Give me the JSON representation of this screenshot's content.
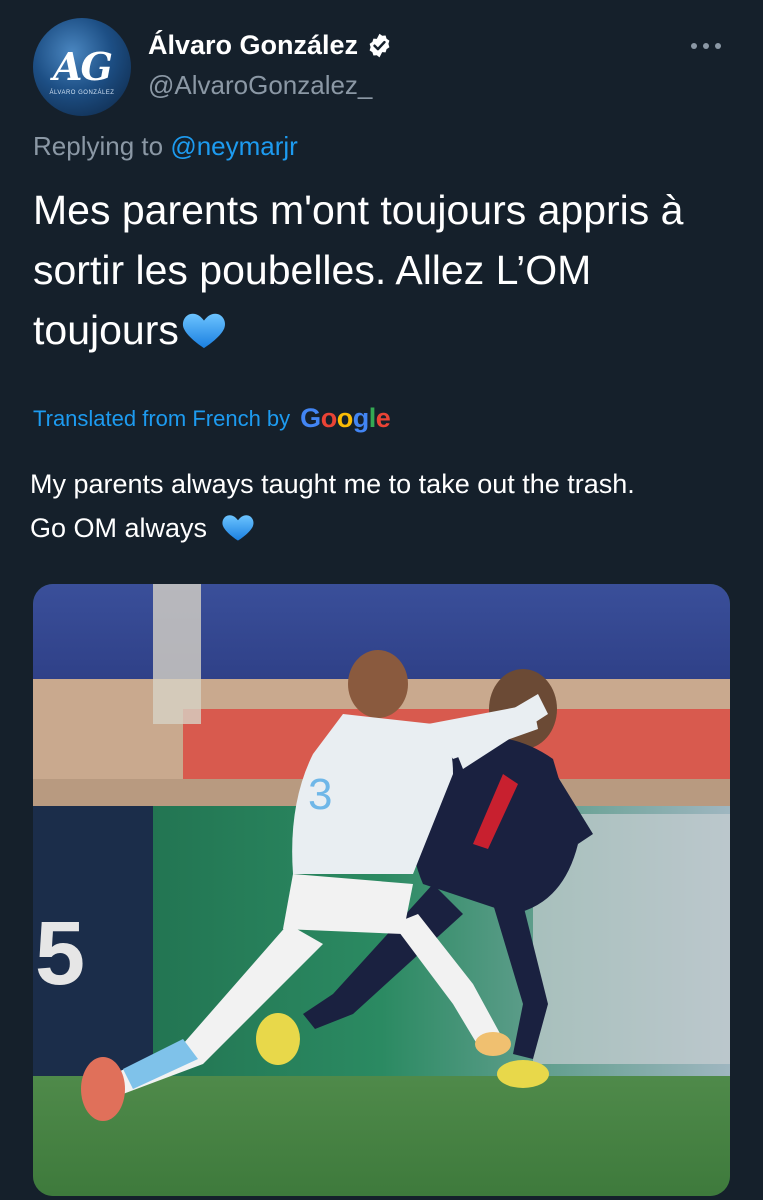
{
  "tweet": {
    "display_name": "Álvaro González",
    "handle": "@AlvaroGonzalez_",
    "verified": true,
    "avatar_text": "AG",
    "avatar_small_text": "ÁLVARO GONZÁLEZ",
    "reply_prefix": "Replying to",
    "reply_mention": "@neymarjr",
    "text_line1": "Mes parents m'ont toujours appris à",
    "text_line2": "sortir les poubelles. Allez L’OM",
    "text_line3": "toujours",
    "text_emoji": "blue-heart-icon",
    "translated_label": "Translated from French by",
    "google_letters": [
      "G",
      "o",
      "o",
      "g",
      "l",
      "e"
    ],
    "translation_line1": "My parents always taught me to take out the trash.",
    "translation_line2": "Go OM always",
    "more_icon": "more-options-icon"
  },
  "media": {
    "description_icon": "football-photo",
    "player_number": "3"
  },
  "colors": {
    "background": "#15202b",
    "link": "#1d9bf0",
    "secondary_text": "#8b98a5",
    "verified": "#ffffff",
    "heart": "#1d9bf0"
  }
}
